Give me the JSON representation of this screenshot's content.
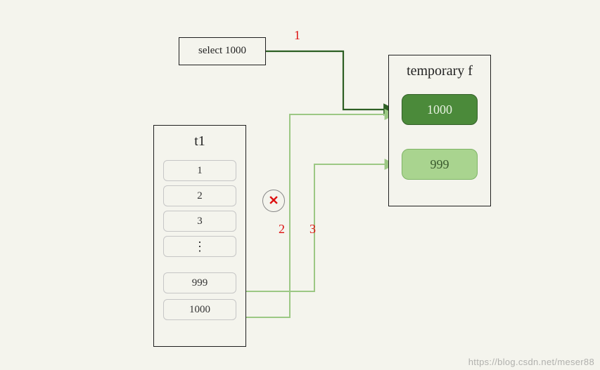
{
  "select_box": {
    "label": "select 1000"
  },
  "t1": {
    "title": "t1",
    "rows": [
      "1",
      "2",
      "3",
      "⋮",
      "999",
      "1000"
    ]
  },
  "temp": {
    "title": "temporary f",
    "items": [
      {
        "key": "pill_1000",
        "label": "1000",
        "style": "dark"
      },
      {
        "key": "pill_999",
        "label": "999",
        "style": "light"
      }
    ]
  },
  "step_labels": {
    "s1": "1",
    "s2": "2",
    "s3": "3"
  },
  "reject_icon": "✕",
  "watermark": "https://blog.csdn.net/meser88"
}
